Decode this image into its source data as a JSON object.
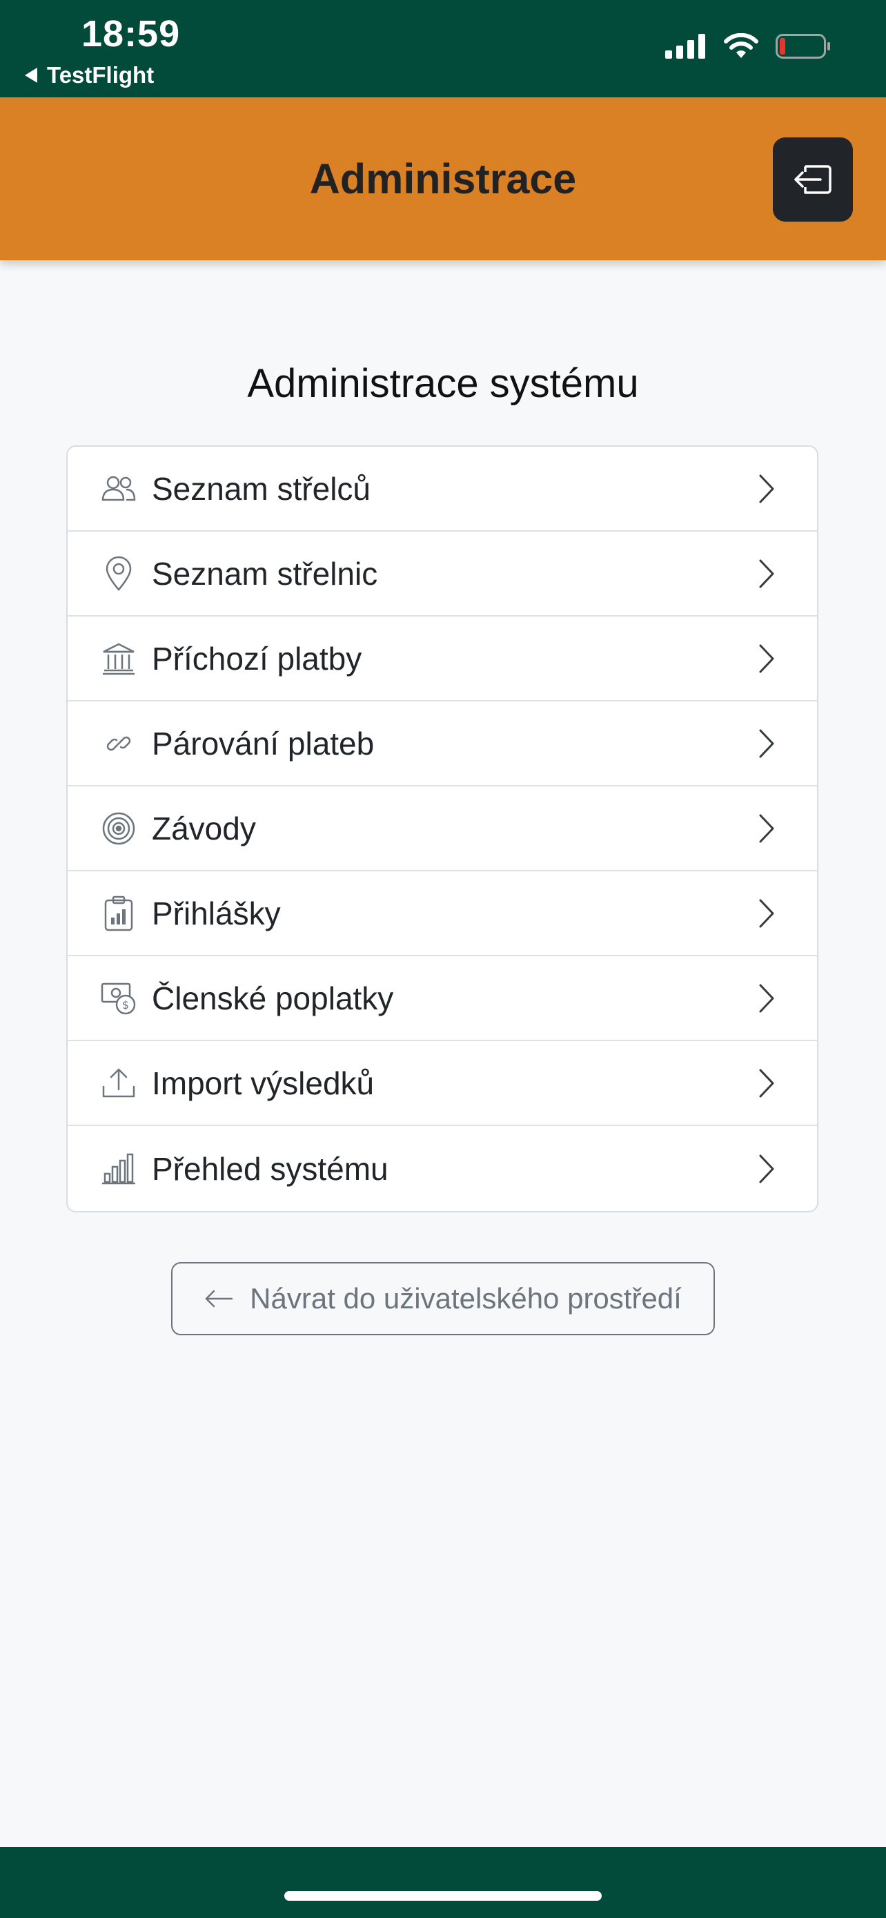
{
  "status_bar": {
    "time": "18:59",
    "back_app": "TestFlight"
  },
  "header": {
    "title": "Administrace",
    "logout_icon": "logout-icon"
  },
  "main": {
    "section_title": "Administrace systému",
    "menu_items": [
      {
        "label": "Seznam střelců",
        "icon": "users-icon"
      },
      {
        "label": "Seznam střelnic",
        "icon": "location-pin-icon"
      },
      {
        "label": "Příchozí platby",
        "icon": "bank-icon"
      },
      {
        "label": "Párování plateb",
        "icon": "link-icon"
      },
      {
        "label": "Závody",
        "icon": "target-icon"
      },
      {
        "label": "Přihlášky",
        "icon": "clipboard-chart-icon"
      },
      {
        "label": "Členské poplatky",
        "icon": "cash-coin-icon"
      },
      {
        "label": "Import výsledků",
        "icon": "upload-icon"
      },
      {
        "label": "Přehled systému",
        "icon": "bar-chart-icon"
      }
    ],
    "back_button_label": "Návrat do uživatelského prostředí"
  },
  "colors": {
    "status_bar_bg": "#024a3a",
    "header_bg": "#d98124",
    "logout_button_bg": "#212529",
    "page_bg": "#f7f8fa"
  }
}
